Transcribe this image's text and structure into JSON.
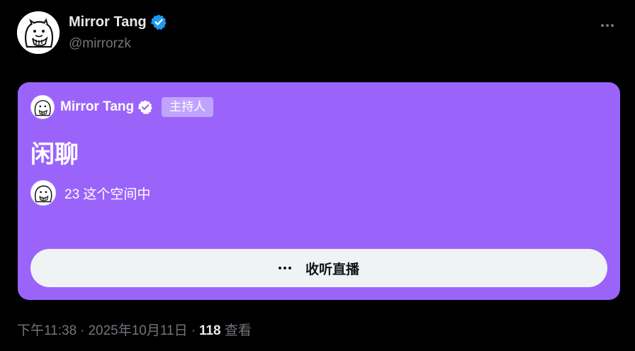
{
  "author": {
    "display_name": "Mirror Tang",
    "handle": "@mirrorzk",
    "verified_icon": "verified-badge-icon",
    "verified_color": "#1d9bf0"
  },
  "menu": {
    "icon": "more-horizontal-icon"
  },
  "space": {
    "background_color": "#9a64fb",
    "host_name": "Mirror Tang",
    "host_badge": "主持人",
    "title": "闲聊",
    "listener_text": "23 这个空间中",
    "button_label": "收听直播",
    "button_icon": "more-horizontal-icon"
  },
  "meta": {
    "time": "下午11:38",
    "date": "2025年10月11日",
    "separator": "·",
    "views_count": "118",
    "views_label": "查看"
  }
}
